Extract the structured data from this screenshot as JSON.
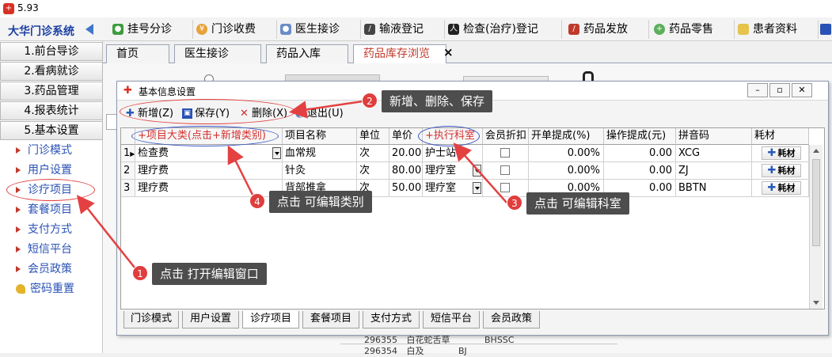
{
  "window": {
    "title": "5.93"
  },
  "system_name": "大华门诊系统",
  "left_menu": {
    "modules": [
      "1.前台导诊",
      "2.看病就诊",
      "3.药品管理",
      "4.报表统计",
      "5.基本设置"
    ],
    "sub_items": [
      "门诊模式",
      "用户设置",
      "诊疗项目",
      "套餐项目",
      "支付方式",
      "短信平台",
      "会员政策"
    ],
    "password_reset": "密码重置"
  },
  "top_tabs": [
    "挂号分诊",
    "门诊收费",
    "医生接诊",
    "输液登记",
    "检查(治疗)登记",
    "药品发放",
    "药品零售",
    "患者资料"
  ],
  "doc_tabs": [
    "首页",
    "医生接诊",
    "药品入库",
    "药品库存浏览"
  ],
  "doc_tab_close": "×",
  "dialog": {
    "title": "基本信息设置",
    "toolbar": {
      "add": "新增(Z)",
      "save": "保存(Y)",
      "delete": "删除(X)",
      "exit": "退出(U)"
    },
    "columns": [
      "+项目大类(点击+新增类别)",
      "项目名称",
      "单位",
      "单价",
      "+执行科室",
      "会员折扣",
      "开单提成(%)",
      "操作提成(元)",
      "拼音码",
      "耗材"
    ],
    "rows": [
      {
        "num": "1",
        "category": "检查费",
        "name": "血常规",
        "unit": "次",
        "price": "20.00",
        "dept": "护士站",
        "rate": "0.00%",
        "fee": "0.00",
        "pinyin": "XCG",
        "consumable": "耗材"
      },
      {
        "num": "2",
        "category": "理疗费",
        "name": "针灸",
        "unit": "次",
        "price": "80.00",
        "dept": "理疗室",
        "rate": "0.00%",
        "fee": "0.00",
        "pinyin": "ZJ",
        "consumable": "耗材"
      },
      {
        "num": "3",
        "category": "理疗费",
        "name": "背部推拿",
        "unit": "次",
        "price": "50.00",
        "dept": "理疗室",
        "rate": "0.00%",
        "fee": "0.00",
        "pinyin": "BBTN",
        "consumable": "耗材"
      }
    ],
    "bottom_tabs": [
      "门诊模式",
      "用户设置",
      "诊疗项目",
      "套餐项目",
      "支付方式",
      "短信平台",
      "会员政策"
    ],
    "active_bottom_tab": "诊疗项目"
  },
  "background_rows": [
    {
      "code": "296355",
      "name": "白花蛇舌草",
      "py": "BHSSC"
    },
    {
      "code": "296354",
      "name": "白及",
      "py": "BJ"
    }
  ],
  "annotations": [
    {
      "num": "1",
      "text": "点击 打开编辑窗口"
    },
    {
      "num": "2",
      "text": "新增、删除、保存"
    },
    {
      "num": "3",
      "text": "点击 可编辑科室"
    },
    {
      "num": "4",
      "text": "点击 可编辑类别"
    }
  ],
  "colors": {
    "annotation_red": "#e03d3d",
    "link_blue": "#2a52b5",
    "active_tab_red": "#c0392b"
  }
}
